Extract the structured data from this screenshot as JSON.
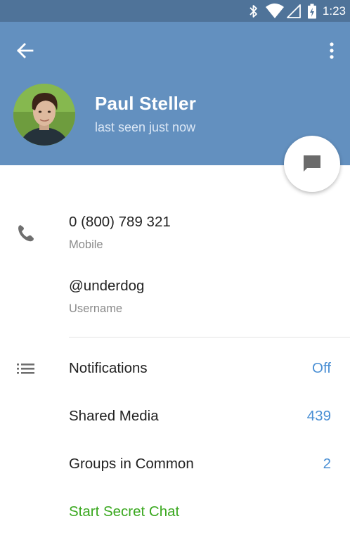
{
  "status_bar": {
    "time": "1:23",
    "icons": [
      "bluetooth-icon",
      "wifi-icon",
      "signal-icon",
      "battery-charging-icon"
    ]
  },
  "header": {
    "back_icon": "arrow-left-icon",
    "menu_icon": "more-vertical-icon",
    "name": "Paul Steller",
    "status": "last seen just now",
    "fab_icon": "chat-bubble-icon"
  },
  "info": {
    "phone": {
      "icon": "phone-icon",
      "value": "0 (800) 789 321",
      "label": "Mobile"
    },
    "username": {
      "value": "@underdog",
      "label": "Username"
    }
  },
  "settings": {
    "section_icon": "list-icon",
    "rows": [
      {
        "label": "Notifications",
        "value": "Off"
      },
      {
        "label": "Shared Media",
        "value": "439"
      },
      {
        "label": "Groups in Common",
        "value": "2"
      }
    ],
    "secret_chat": "Start Secret Chat"
  },
  "colors": {
    "status_bar": "#4f7399",
    "header": "#6390bf",
    "accent_blue": "#4a8fd4",
    "secret_green": "#3aa81f"
  }
}
